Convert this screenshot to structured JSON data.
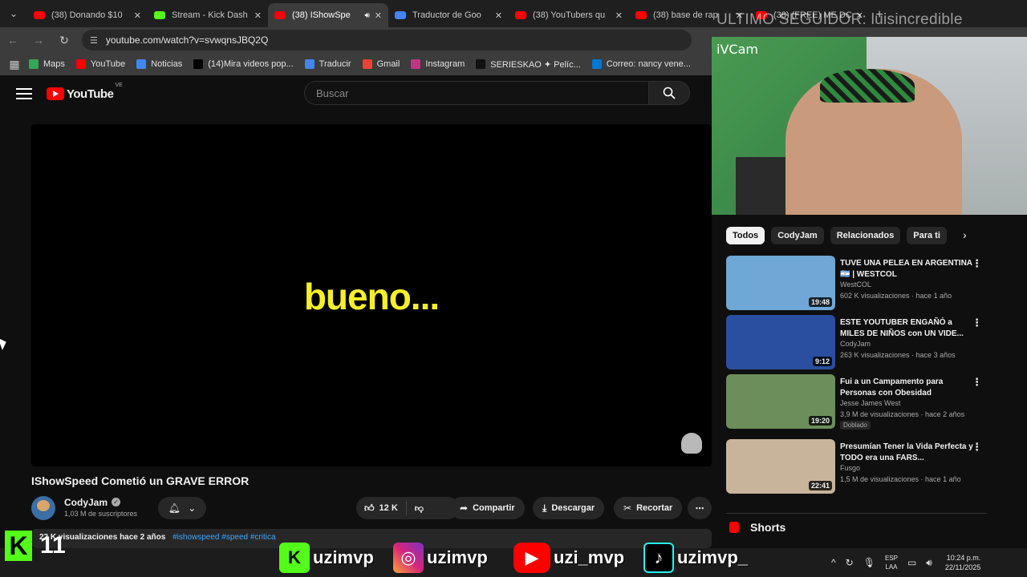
{
  "browser": {
    "tabs": [
      {
        "title": "(38) Donando $10",
        "favicon_color": "#ff0000",
        "active": false
      },
      {
        "title": "Stream - Kick Dash",
        "favicon_color": "#53fc18",
        "active": false
      },
      {
        "title": "(38) IShowSpe",
        "favicon_color": "#ff0000",
        "active": true
      },
      {
        "title": "Traductor de Goo",
        "favicon_color": "#4285f4",
        "active": false
      },
      {
        "title": "(38) YouTubers qu",
        "favicon_color": "#ff0000",
        "active": false
      },
      {
        "title": "(38) base de rap",
        "favicon_color": "#ff0000",
        "active": false
      },
      {
        "title": "(38) (FREE) ME DC",
        "favicon_color": "#ff0000",
        "active": false
      }
    ],
    "url": "youtube.com/watch?v=svwqnsJBQ2Q",
    "bookmarks": [
      {
        "label": "Maps",
        "color": "#34a853"
      },
      {
        "label": "YouTube",
        "color": "#ff0000"
      },
      {
        "label": "Noticias",
        "color": "#4285f4"
      },
      {
        "label": "(14)Mira videos pop...",
        "color": "#000000"
      },
      {
        "label": "Traducir",
        "color": "#4285f4"
      },
      {
        "label": "Gmail",
        "color": "#ea4335"
      },
      {
        "label": "Instagram",
        "color": "#c13584"
      },
      {
        "label": "SERIESKAO ✦ Pelíc...",
        "color": "#111111"
      },
      {
        "label": "Correo: nancy vene...",
        "color": "#0078d4"
      }
    ]
  },
  "overlay": {
    "follower_text": "ULTIMO SEGUIDOR: luisincredible",
    "webcam_label": "iVCam"
  },
  "youtube": {
    "logo_text": "YouTube",
    "country_code": "VE",
    "search_placeholder": "Buscar",
    "video": {
      "caption": "bueno...",
      "title": "IShowSpeed Cometió un GRAVE ERROR",
      "channel": "CodyJam",
      "subscribers": "1,03 M de suscriptores",
      "likes": "12 K",
      "share_label": "Compartir",
      "download_label": "Descargar",
      "clip_label": "Recortar",
      "views_partial": "22 K visualizaciones",
      "age": "hace 2 años",
      "hashtags": "#ishowspeed #speed #critica"
    },
    "chips": [
      "Todos",
      "CodyJam",
      "Relacionados",
      "Para ti"
    ],
    "recommendations": [
      {
        "title": "TUVE UNA PELEA EN ARGENTINA 🇦🇷 | WESTCOL",
        "channel": "WestCOL",
        "meta": "602 K visualizaciones · hace 1 año",
        "duration": "19:48",
        "thumb_color": "#6fa8d6",
        "tag": ""
      },
      {
        "title": "ESTE YOUTUBER ENGAÑÓ a MILES DE NIÑOS con UN VIDE...",
        "channel": "CodyJam",
        "meta": "263 K visualizaciones · hace 3 años",
        "duration": "9:12",
        "thumb_color": "#2a4fa0",
        "tag": ""
      },
      {
        "title": "Fui a un Campamento para Personas con Obesidad",
        "channel": "Jesse James West",
        "meta": "3,9 M de visualizaciones · hace 2 años",
        "duration": "19:20",
        "thumb_color": "#6b8e5a",
        "tag": "Doblado"
      },
      {
        "title": "Presumían Tener la Vida Perfecta y TODO era una FARS...",
        "channel": "Fusgo",
        "meta": "1,5 M de visualizaciones · hace 1 año",
        "duration": "22:41",
        "thumb_color": "#c8b49a",
        "tag": ""
      }
    ],
    "shorts_label": "Shorts"
  },
  "stream_overlay": {
    "kick_count": "11",
    "handles": [
      "uzimvp",
      "uzimvp",
      "uzi_mvp",
      "uzimvp_"
    ]
  },
  "taskbar": {
    "lang_top": "ESP",
    "lang_bottom": "LAA",
    "time": "10:24 p.m.",
    "date": "22/11/2025"
  }
}
